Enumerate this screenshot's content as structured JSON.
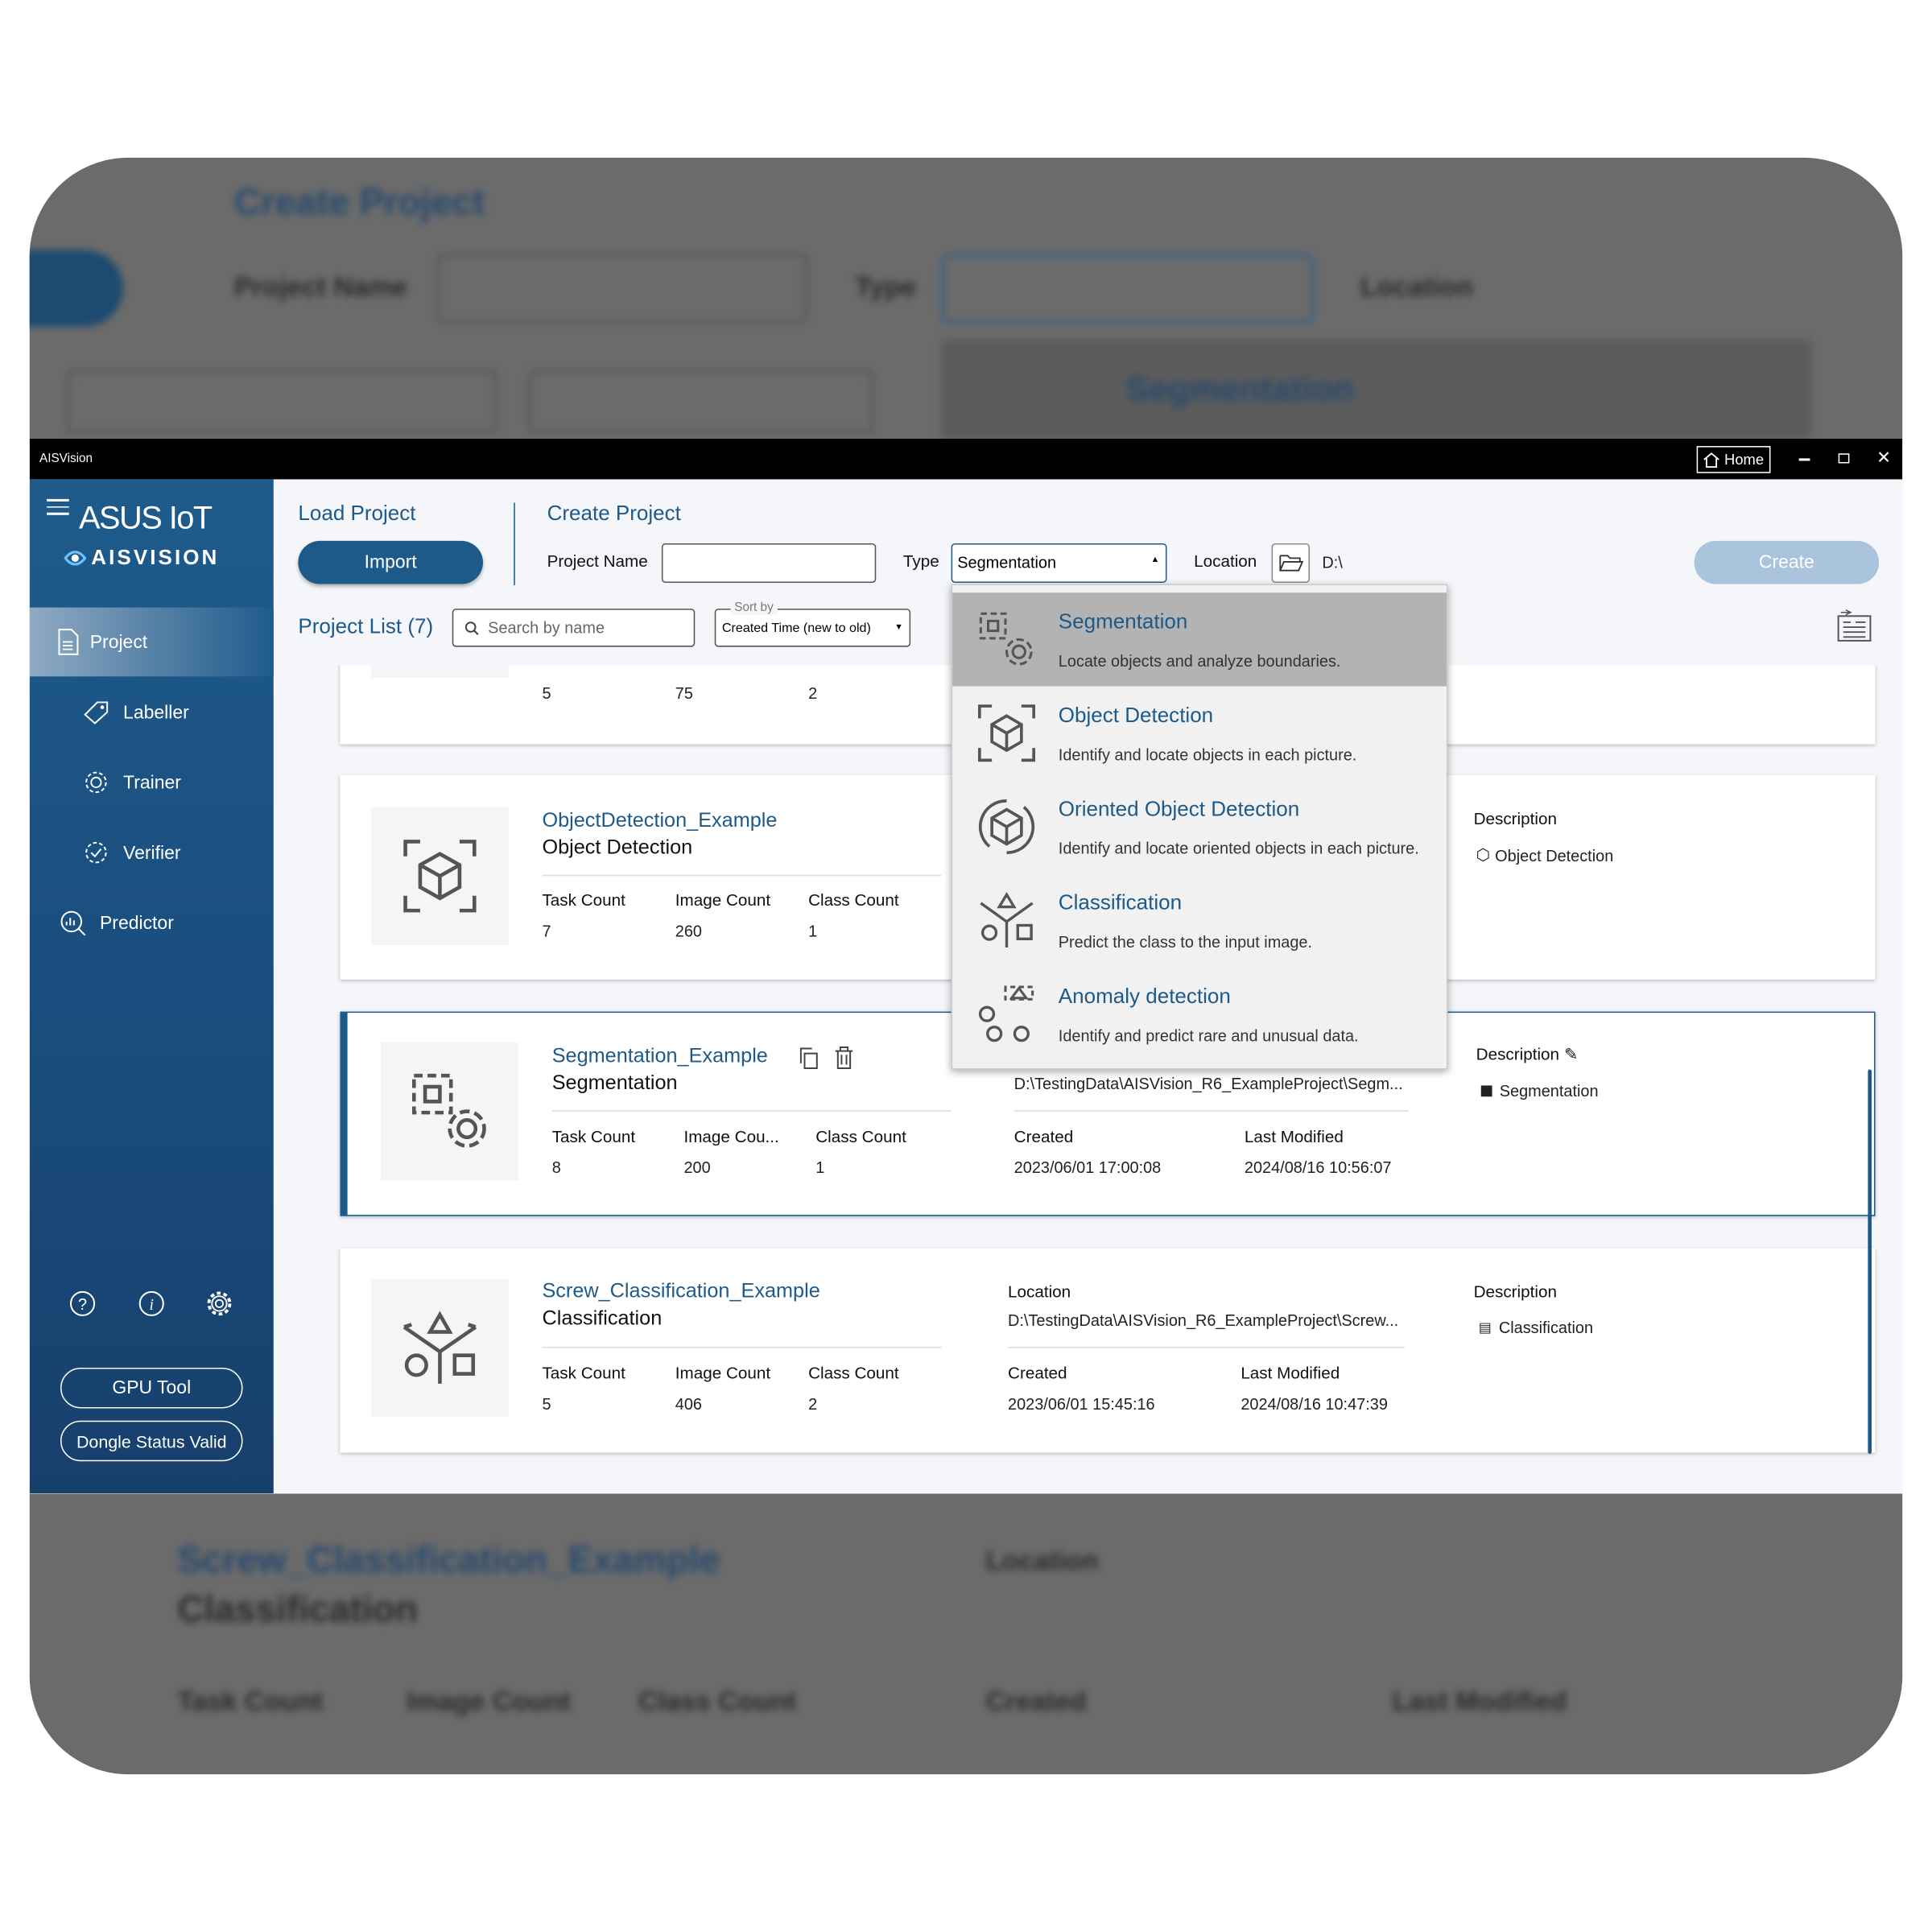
{
  "app": {
    "title": "AISVision",
    "home_label": "Home",
    "brand_top": "ASUS IoT",
    "brand_bottom": "AISVISION"
  },
  "colors": {
    "accent": "#1d5a8a",
    "create_disabled": "#a9c4dc",
    "dropdown_highlight": "#b3b3b3",
    "backdrop": "#6b6b6b"
  },
  "sidebar": {
    "items": [
      {
        "label": "Project",
        "icon": "document-list-icon",
        "selected": true
      },
      {
        "label": "Labeller",
        "icon": "tag-icon"
      },
      {
        "label": "Trainer",
        "icon": "gear-chip-icon"
      },
      {
        "label": "Verifier",
        "icon": "gear-check-icon"
      },
      {
        "label": "Predictor",
        "icon": "chart-magnifier-icon"
      }
    ],
    "bottom_icons": [
      "help-icon",
      "info-icon",
      "settings-icon"
    ],
    "gpu_tool": "GPU Tool",
    "dongle": "Dongle Status Valid"
  },
  "load": {
    "title": "Load Project",
    "import": "Import"
  },
  "create": {
    "title": "Create Project",
    "name_label": "Project Name",
    "name_value": "",
    "type_label": "Type",
    "type_value": "Segmentation",
    "location_label": "Location",
    "location_value": "D:\\",
    "create_button": "Create"
  },
  "list": {
    "title": "Project List (7)",
    "search_placeholder": "Search by name",
    "sort_label": "Sort by",
    "sort_value": "Created Time (new to old)"
  },
  "type_options": [
    {
      "title": "Segmentation",
      "desc": "Locate objects and analyze boundaries.",
      "icon": "segmentation-icon",
      "highlighted": true
    },
    {
      "title": "Object Detection",
      "desc": "Identify and locate objects in each picture.",
      "icon": "object-detection-icon"
    },
    {
      "title": "Oriented Object Detection",
      "desc": "Identify and locate oriented objects in each picture.",
      "icon": "oriented-detection-icon"
    },
    {
      "title": "Classification",
      "desc": "Predict the class to the input image.",
      "icon": "classification-icon"
    },
    {
      "title": "Anomaly detection",
      "desc": "Identify and predict rare and unusual data.",
      "icon": "anomaly-icon"
    }
  ],
  "labels": {
    "task": "Task Count",
    "image": "Image Count",
    "image_trunc": "Image Cou...",
    "class": "Class Count",
    "location": "Location",
    "created": "Created",
    "modified": "Last Modified",
    "description": "Description"
  },
  "projects": [
    {
      "task": "5",
      "image": "75",
      "class": "2"
    },
    {
      "name": "ObjectDetection_Example",
      "type": "Object Detection",
      "task": "7",
      "image": "260",
      "class": "1",
      "description": "Object Detection"
    },
    {
      "name": "Segmentation_Example",
      "type": "Segmentation",
      "task": "8",
      "image": "200",
      "class": "1",
      "location": "D:\\TestingData\\AISVision_R6_ExampleProject\\Segm...",
      "created": "2023/06/01 17:00:08",
      "modified": "2024/08/16 10:56:07",
      "description": "Segmentation",
      "selected": true
    },
    {
      "name": "Screw_Classification_Example",
      "type": "Classification",
      "task": "5",
      "image": "406",
      "class": "2",
      "location": "D:\\TestingData\\AISVision_R6_ExampleProject\\Screw...",
      "created": "2023/06/01 15:45:16",
      "modified": "2024/08/16 10:47:39",
      "description": "Classification"
    }
  ]
}
